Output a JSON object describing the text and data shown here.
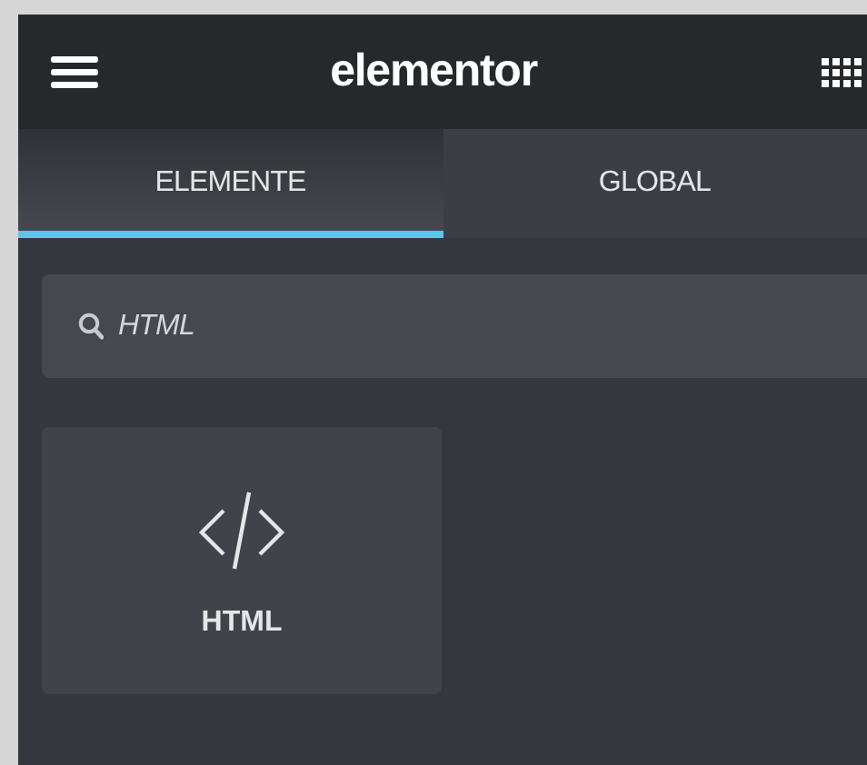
{
  "header": {
    "title": "elementor"
  },
  "tabs": [
    {
      "label": "ELEMENTE",
      "selected": true
    },
    {
      "label": "GLOBAL",
      "selected": false
    }
  ],
  "search": {
    "value": "HTML"
  },
  "widgets": [
    {
      "label": "HTML"
    }
  ]
}
